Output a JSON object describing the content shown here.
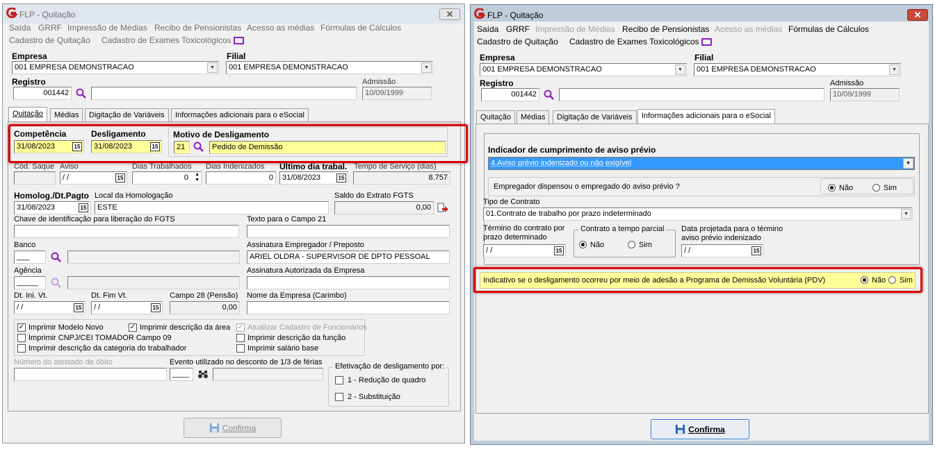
{
  "window_title": "FLP - Quitação",
  "close_symbol": "✕",
  "menu": {
    "saida": "Saída",
    "grrf": "GRRF",
    "impressao_medias": "Impressão de Médias",
    "recibo_pensionistas": "Recibo de Pensionistas",
    "acesso_medias": "Acesso as médias",
    "formulas_calculos": "Fórmulas de Cálculos",
    "cadastro_quitacao": "Cadastro de Quitação",
    "cadastro_exames": "Cadastro de Exames Toxicológicos"
  },
  "header": {
    "empresa_label": "Empresa",
    "empresa_value": "001 EMPRESA DEMONSTRACAO",
    "filial_label": "Filial",
    "filial_value": "001 EMPRESA DEMONSTRACAO",
    "registro_label": "Registro",
    "registro_value": "001442",
    "admissao_label": "Admissão",
    "admissao_value": "10/09/1999"
  },
  "tabs": [
    "Quitação",
    "Médias",
    "Digitação de Variáveis",
    "Informações adicionais para o eSocial"
  ],
  "left": {
    "competencia_label": "Competência",
    "competencia_value": "31/08/2023",
    "desligamento_label": "Desligamento",
    "desligamento_value": "31/08/2023",
    "motivo_label": "Motivo de Desligamento",
    "motivo_code": "21",
    "motivo_value": "Pedido de Demissão",
    "cod_saque_label": "Cód. Saque",
    "aviso_label": "Aviso",
    "aviso_value": " / /",
    "dias_trab_label": "Dias Trabalhados",
    "dias_trab_value": "0",
    "dias_inden_label": "Dias Indenizados",
    "dias_inden_value": "0",
    "ultimo_dia_label": "Último dia trabal.",
    "ultimo_dia_value": "31/08/2023",
    "tempo_servico_label": "Tempo de Serviço (dias)",
    "tempo_servico_value": "8.757",
    "homolog_label": "Homolog./Dt.Pagto",
    "homolog_value": "31/08/2023",
    "local_homolog_label": "Local da Homologação",
    "local_homolog_value": "ESTE",
    "saldo_fgts_label": "Saldo do Extrato FGTS",
    "saldo_fgts_value": "0,00",
    "chave_fgts_label": "Chave de identificação para liberação do FGTS",
    "texto_campo21_label": "Texto para o Campo 21",
    "banco_label": "Banco",
    "banco_value": "___",
    "assinatura_emp_label": "Assinatura Empregador / Preposto",
    "assinatura_emp_value": "ARIEL OLDRA - SUPERVISOR DE DPTO PESSOAL",
    "agencia_label": "Agência",
    "agencia_value": "_____",
    "assinatura_aut_label": "Assinatura Autorizada da Empresa",
    "dt_ini_vt_label": "Dt. Ini. Vt.",
    "dt_ini_vt_value": " / /",
    "dt_fim_vt_label": "Dt. Fim Vt.",
    "dt_fim_vt_value": " / /",
    "campo28_label": "Campo 28 (Pensão)",
    "campo28_value": "0,00",
    "nome_empresa_label": "Nome da Empresa (Carimbo)",
    "chk_modelo_novo": "Imprimir Modelo Novo",
    "chk_descricao_area": "Imprimir descrição da área",
    "chk_atualizar_cadastro": "Atualizar Cadastro de Funcionários",
    "chk_cnpj": "Imprimir CNPJ/CEI TOMADOR Campo 09",
    "chk_descricao_funcao": "Imprimir descrição da função",
    "chk_categoria": "Imprimir descrição da categoria do trabalhador",
    "chk_salario_base": "Imprimir salário base",
    "atestado_obito_label": "Número do atestado de óbito",
    "evento_label": "Evento utilizado no desconto de 1/3 de férias",
    "evento_value": "____",
    "efetivacao_label": "Efetivação de desligamento por:",
    "efetivacao_opt1": "1 - Redução de quadro",
    "efetivacao_opt2": "2 - Substituição",
    "confirm_label": "Confirma"
  },
  "right": {
    "aviso_previo_title": "Indicador de cumprimento de aviso prévio",
    "aviso_previo_value": "4.Aviso prévio indenizado ou não exigível",
    "dispensou_label": "Empregador dispensou o empregado do aviso prévio ?",
    "opt_nao": "Não",
    "opt_sim": "Sim",
    "tipo_contrato_label": "Tipo de Contrato",
    "tipo_contrato_value": "01.Contrato de trabalho por prazo indeterminado",
    "termino_label_1": "Término do contrato por",
    "termino_label_2": "prazo determinado",
    "termino_value": " / /",
    "tempo_parcial_label": "Contrato a tempo parcial",
    "data_projetada_label_1": "Data projetada para o término",
    "data_projetada_label_2": "aviso prévio indenizado",
    "data_projetada_value": " / /",
    "pdv_label": "Indicativo se o desligamento ocorreu por meio de adesão a Programa de Demissão Voluntária (PDV)",
    "confirm_label": "Confirma"
  },
  "colors": {
    "highlight_red": "#d90000",
    "yellow_fill": "#ffff99",
    "selection_blue": "#3399ff",
    "logo_red": "#c81e1e",
    "icon_purple": "#8b1fc0"
  }
}
